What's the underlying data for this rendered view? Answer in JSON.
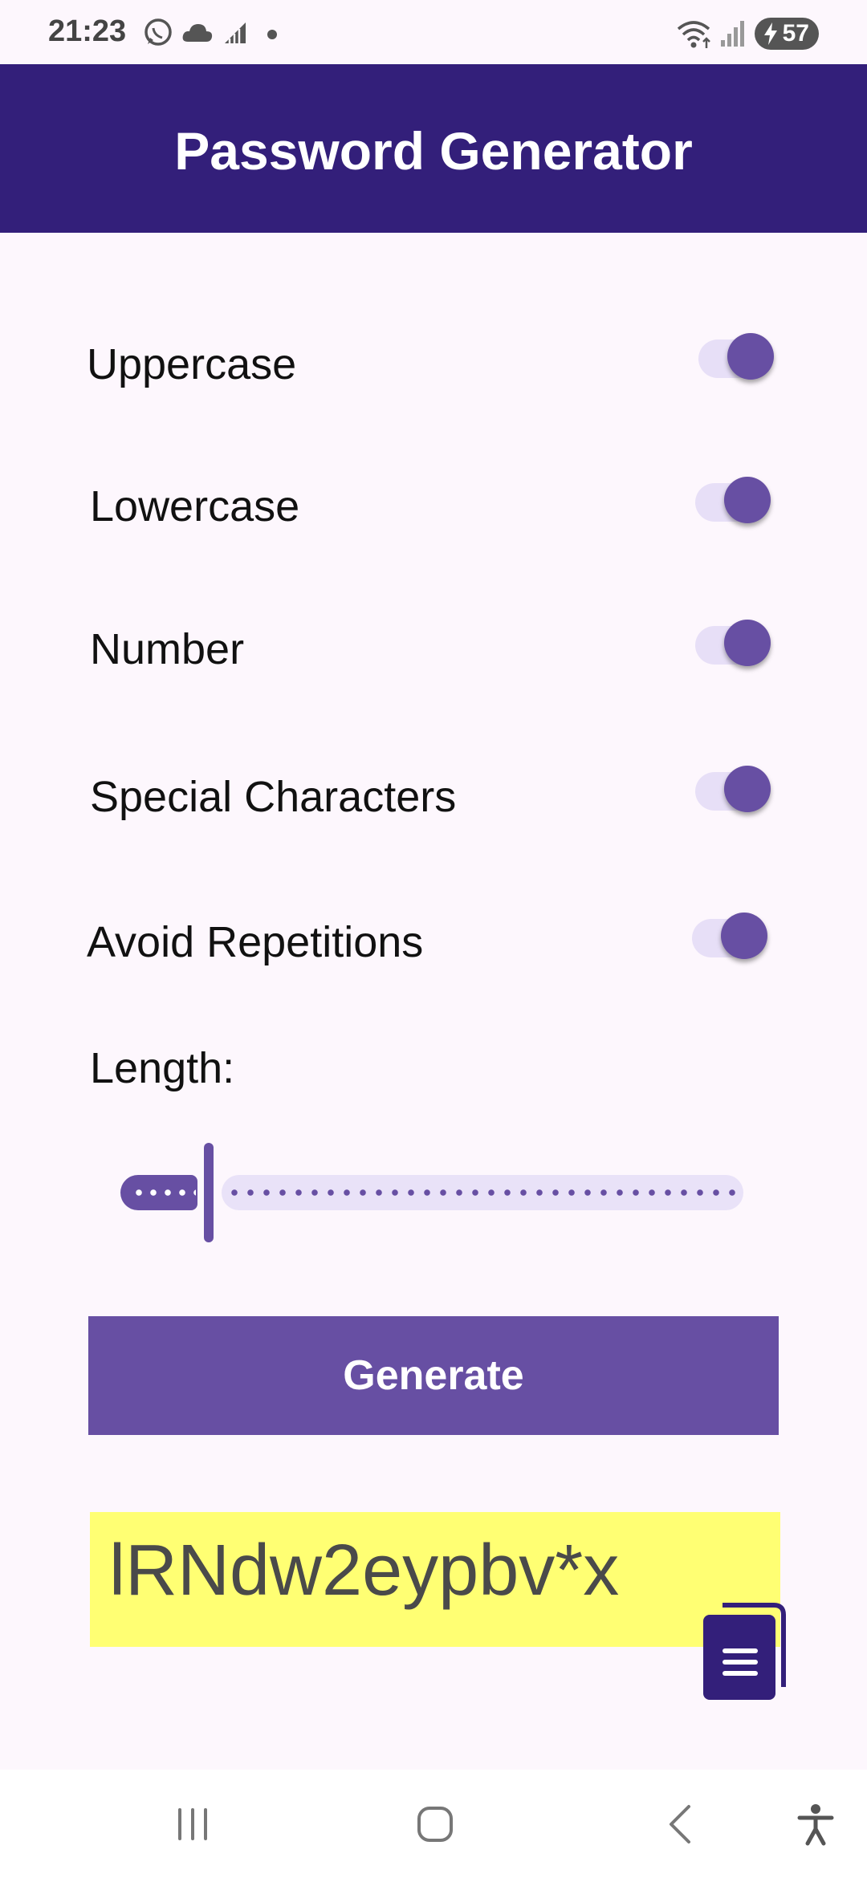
{
  "status_bar": {
    "time": "21:23",
    "battery": "57",
    "left_icons": [
      "whatsapp-icon",
      "cloud-icon",
      "signal-bars-icon",
      "notification-dot-icon"
    ],
    "right_icons": [
      "wifi-icon",
      "cell-signal-icon",
      "battery-charging-icon"
    ]
  },
  "app_bar": {
    "title": "Password Generator"
  },
  "options": [
    {
      "label": "Uppercase",
      "checked": true
    },
    {
      "label": "Lowercase",
      "checked": true
    },
    {
      "label": "Number",
      "checked": true
    },
    {
      "label": "Special Characters",
      "checked": true
    },
    {
      "label": "Avoid Repetitions",
      "checked": true
    }
  ],
  "length": {
    "label": "Length:",
    "value_fraction": 0.14
  },
  "generate_button": {
    "label": "Generate"
  },
  "password": {
    "value": "lRNdw2eypbv*x"
  },
  "colors": {
    "app_bar": "#331f7a",
    "accent": "#674fa3",
    "track_inactive": "#e7dff7",
    "password_bg": "#ffff73",
    "background": "#fdf7fd"
  },
  "nav_bar": {
    "buttons": [
      "recent-apps-icon",
      "home-icon",
      "back-icon",
      "accessibility-icon"
    ]
  }
}
